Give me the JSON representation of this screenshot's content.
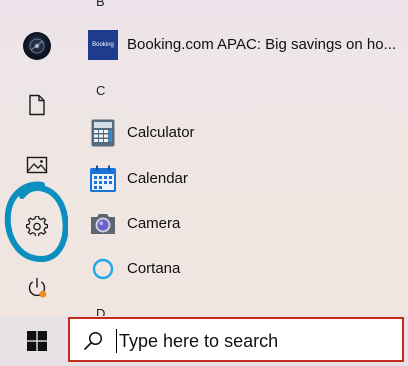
{
  "rail": {
    "items": [
      {
        "name": "user-avatar",
        "icon": "avatar"
      },
      {
        "name": "documents",
        "icon": "document-icon"
      },
      {
        "name": "pictures",
        "icon": "picture-icon"
      },
      {
        "name": "settings",
        "icon": "gear-icon"
      },
      {
        "name": "power",
        "icon": "power-icon"
      }
    ],
    "highlight_color": "#0a8fbf"
  },
  "app_list": {
    "groups": [
      {
        "letter": "B",
        "apps": [
          {
            "label": "Booking.com APAC: Big savings on ho...",
            "tile_text": "Booking",
            "tile_color": "#1d3d8c"
          }
        ]
      },
      {
        "letter": "C",
        "apps": [
          {
            "label": "Calculator",
            "icon": "calculator-icon"
          },
          {
            "label": "Calendar",
            "icon": "calendar-icon"
          },
          {
            "label": "Camera",
            "icon": "camera-icon"
          },
          {
            "label": "Cortana",
            "icon": "cortana-icon"
          }
        ]
      },
      {
        "letter": "D",
        "apps": []
      }
    ]
  },
  "taskbar": {
    "start_icon": "windows-logo-icon",
    "search": {
      "placeholder": "Type here to search",
      "border_color": "#c42b1c"
    }
  }
}
